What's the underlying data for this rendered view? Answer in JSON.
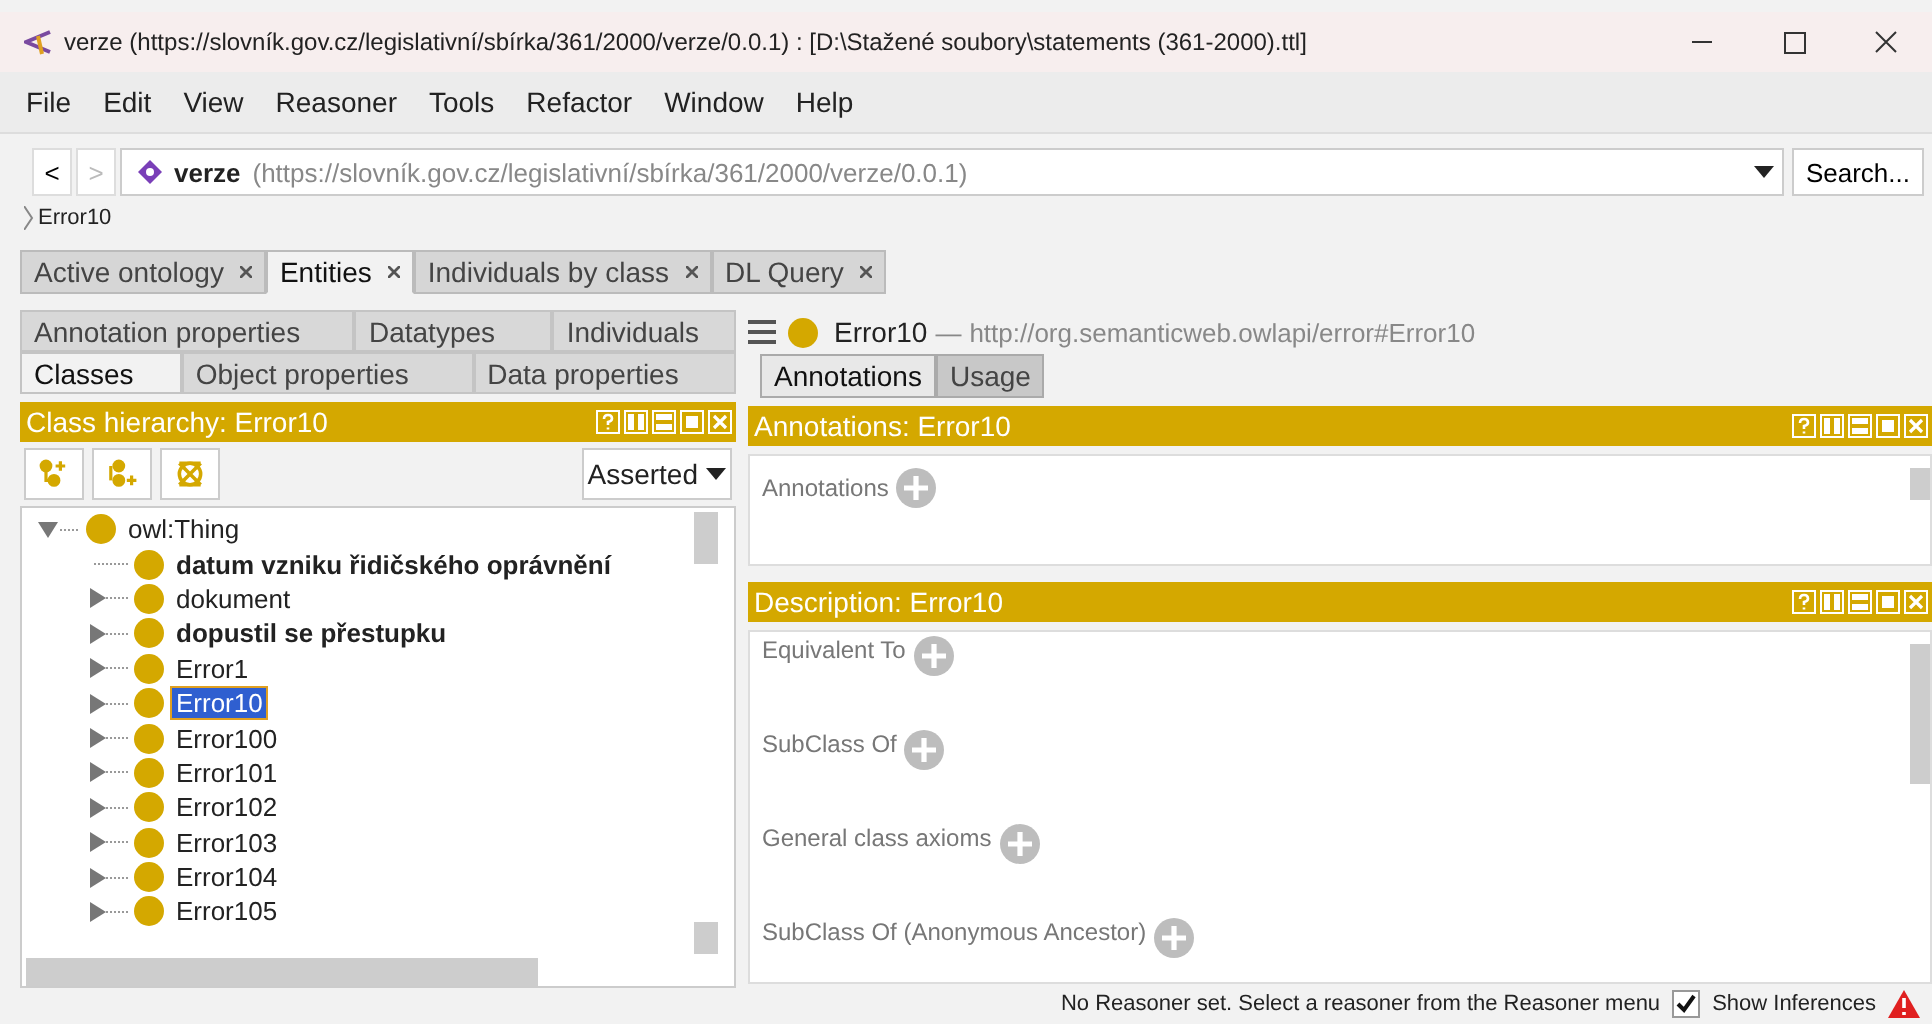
{
  "window": {
    "title": "verze (https://slovník.gov.cz/legislativní/sbírka/361/2000/verze/0.0.1)  : [D:\\Stažené soubory\\statements (361-2000).ttl]"
  },
  "menu": [
    "File",
    "Edit",
    "View",
    "Reasoner",
    "Tools",
    "Refactor",
    "Window",
    "Help"
  ],
  "nav": {
    "back": "<",
    "forward": ">",
    "entity_name": "verze",
    "entity_iri": "(https://slovník.gov.cz/legislativní/sbírka/361/2000/verze/0.0.1)",
    "search_button": "Search..."
  },
  "breadcrumb": "Error10",
  "tabs": [
    {
      "label": "Active ontology",
      "selected": false
    },
    {
      "label": "Entities",
      "selected": true
    },
    {
      "label": "Individuals by class",
      "selected": false
    },
    {
      "label": "DL Query",
      "selected": false
    }
  ],
  "entity_tabs": [
    [
      {
        "label": "Annotation properties",
        "selected": false
      },
      {
        "label": "Datatypes",
        "selected": false
      },
      {
        "label": "Individuals",
        "selected": false
      }
    ],
    [
      {
        "label": "Classes",
        "selected": true
      },
      {
        "label": "Object properties",
        "selected": false
      },
      {
        "label": "Data properties",
        "selected": false
      }
    ]
  ],
  "class_hierarchy": {
    "title": "Class hierarchy: Error10",
    "mode": "Asserted",
    "tree": {
      "label": "owl:Thing",
      "expanded": true,
      "children": [
        {
          "label": "datum vzniku řidičského oprávnění",
          "bold": true,
          "expandable": false,
          "selected": false
        },
        {
          "label": "dokument",
          "bold": false,
          "expandable": true,
          "selected": false
        },
        {
          "label": "dopustil se přestupku",
          "bold": true,
          "expandable": true,
          "selected": false
        },
        {
          "label": "Error1",
          "bold": false,
          "expandable": true,
          "selected": false
        },
        {
          "label": "Error10",
          "bold": false,
          "expandable": true,
          "selected": true
        },
        {
          "label": "Error100",
          "bold": false,
          "expandable": true,
          "selected": false
        },
        {
          "label": "Error101",
          "bold": false,
          "expandable": true,
          "selected": false
        },
        {
          "label": "Error102",
          "bold": false,
          "expandable": true,
          "selected": false
        },
        {
          "label": "Error103",
          "bold": false,
          "expandable": true,
          "selected": false
        },
        {
          "label": "Error104",
          "bold": false,
          "expandable": true,
          "selected": false
        },
        {
          "label": "Error105",
          "bold": false,
          "expandable": true,
          "selected": false
        }
      ]
    }
  },
  "entity_header": {
    "name": "Error10",
    "separator": "—",
    "iri": "http://org.semanticweb.owlapi/error#Error10"
  },
  "detail_tabs": [
    {
      "label": "Annotations",
      "selected": true
    },
    {
      "label": "Usage",
      "selected": false
    }
  ],
  "annotations_panel": {
    "title": "Annotations: Error10",
    "sections": [
      "Annotations"
    ]
  },
  "description_panel": {
    "title": "Description: Error10",
    "sections": [
      "Equivalent To",
      "SubClass Of",
      "General class axioms",
      "SubClass Of (Anonymous Ancestor)"
    ]
  },
  "status_bar": {
    "message": "No Reasoner set. Select a reasoner from the Reasoner menu",
    "show_inferences": {
      "label": "Show Inferences",
      "checked": true
    }
  }
}
